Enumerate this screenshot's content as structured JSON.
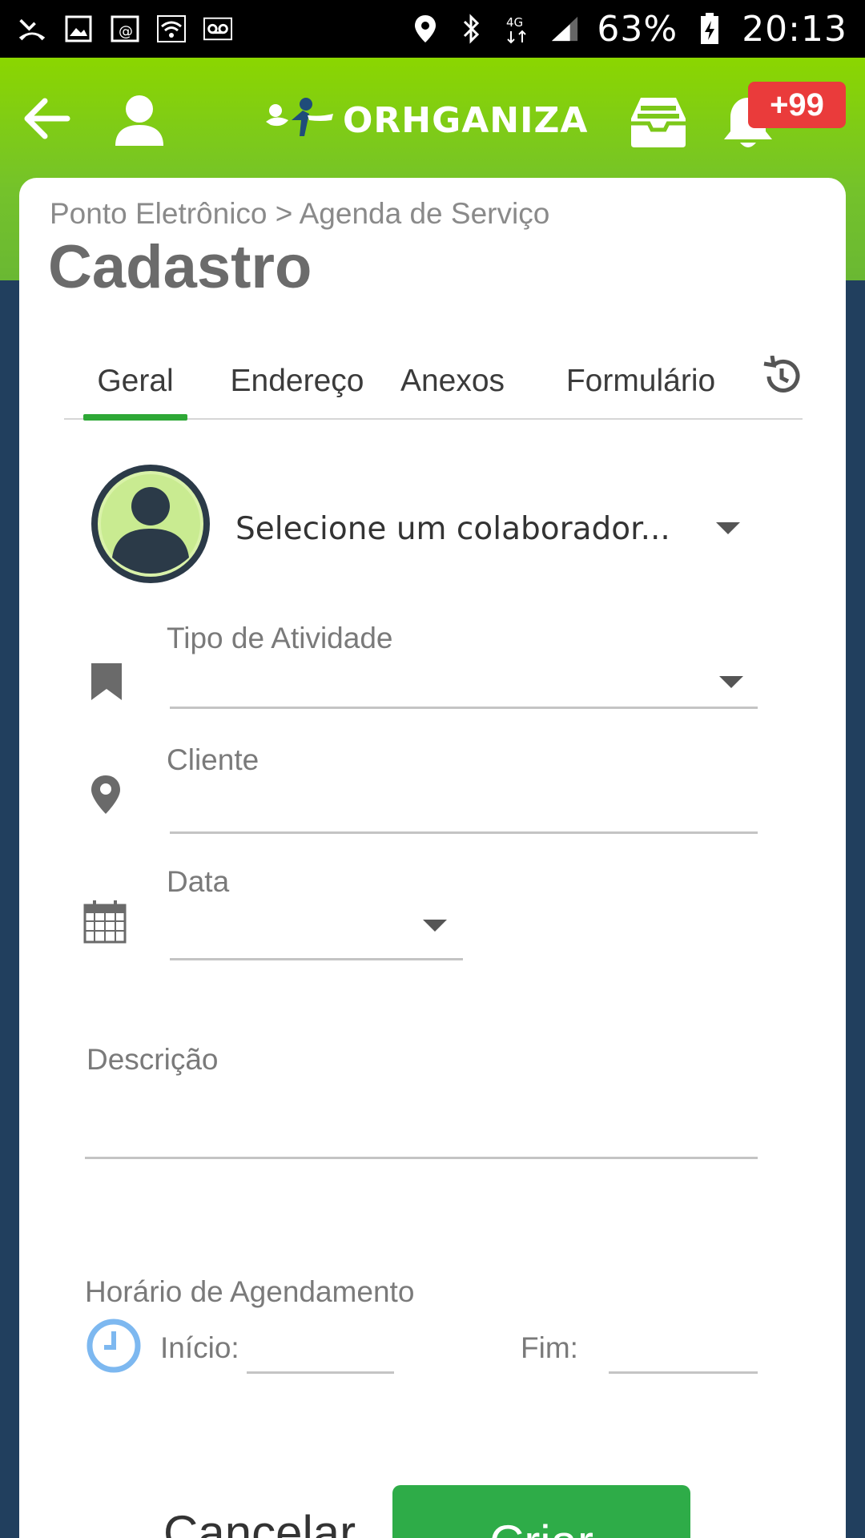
{
  "status_bar": {
    "battery": "63%",
    "time": "20:13",
    "network": "4G"
  },
  "header": {
    "logo_text": "ORHGANIZA",
    "notification_count": "+99"
  },
  "page": {
    "breadcrumb": "Ponto Eletrônico > Agenda de Serviço",
    "title": "Cadastro"
  },
  "tabs": [
    {
      "label": "Geral",
      "active": true
    },
    {
      "label": "Endereço",
      "active": false
    },
    {
      "label": "Anexos",
      "active": false
    },
    {
      "label": "Formulário",
      "active": false
    }
  ],
  "form": {
    "collaborator_placeholder": "Selecione um colaborador...",
    "activity_type_label": "Tipo de Atividade",
    "client_label": "Cliente",
    "date_label": "Data",
    "description_label": "Descrição",
    "schedule_label": "Horário de Agendamento",
    "start_label": "Início:",
    "end_label": "Fim:"
  },
  "actions": {
    "cancel_label": "Cancelar",
    "create_label": "Criar"
  },
  "colors": {
    "header_green": "#8bd600",
    "tab_active": "#2ea836",
    "create_button": "#2eac48",
    "badge": "#ea3b3b",
    "background": "#213f5e"
  }
}
